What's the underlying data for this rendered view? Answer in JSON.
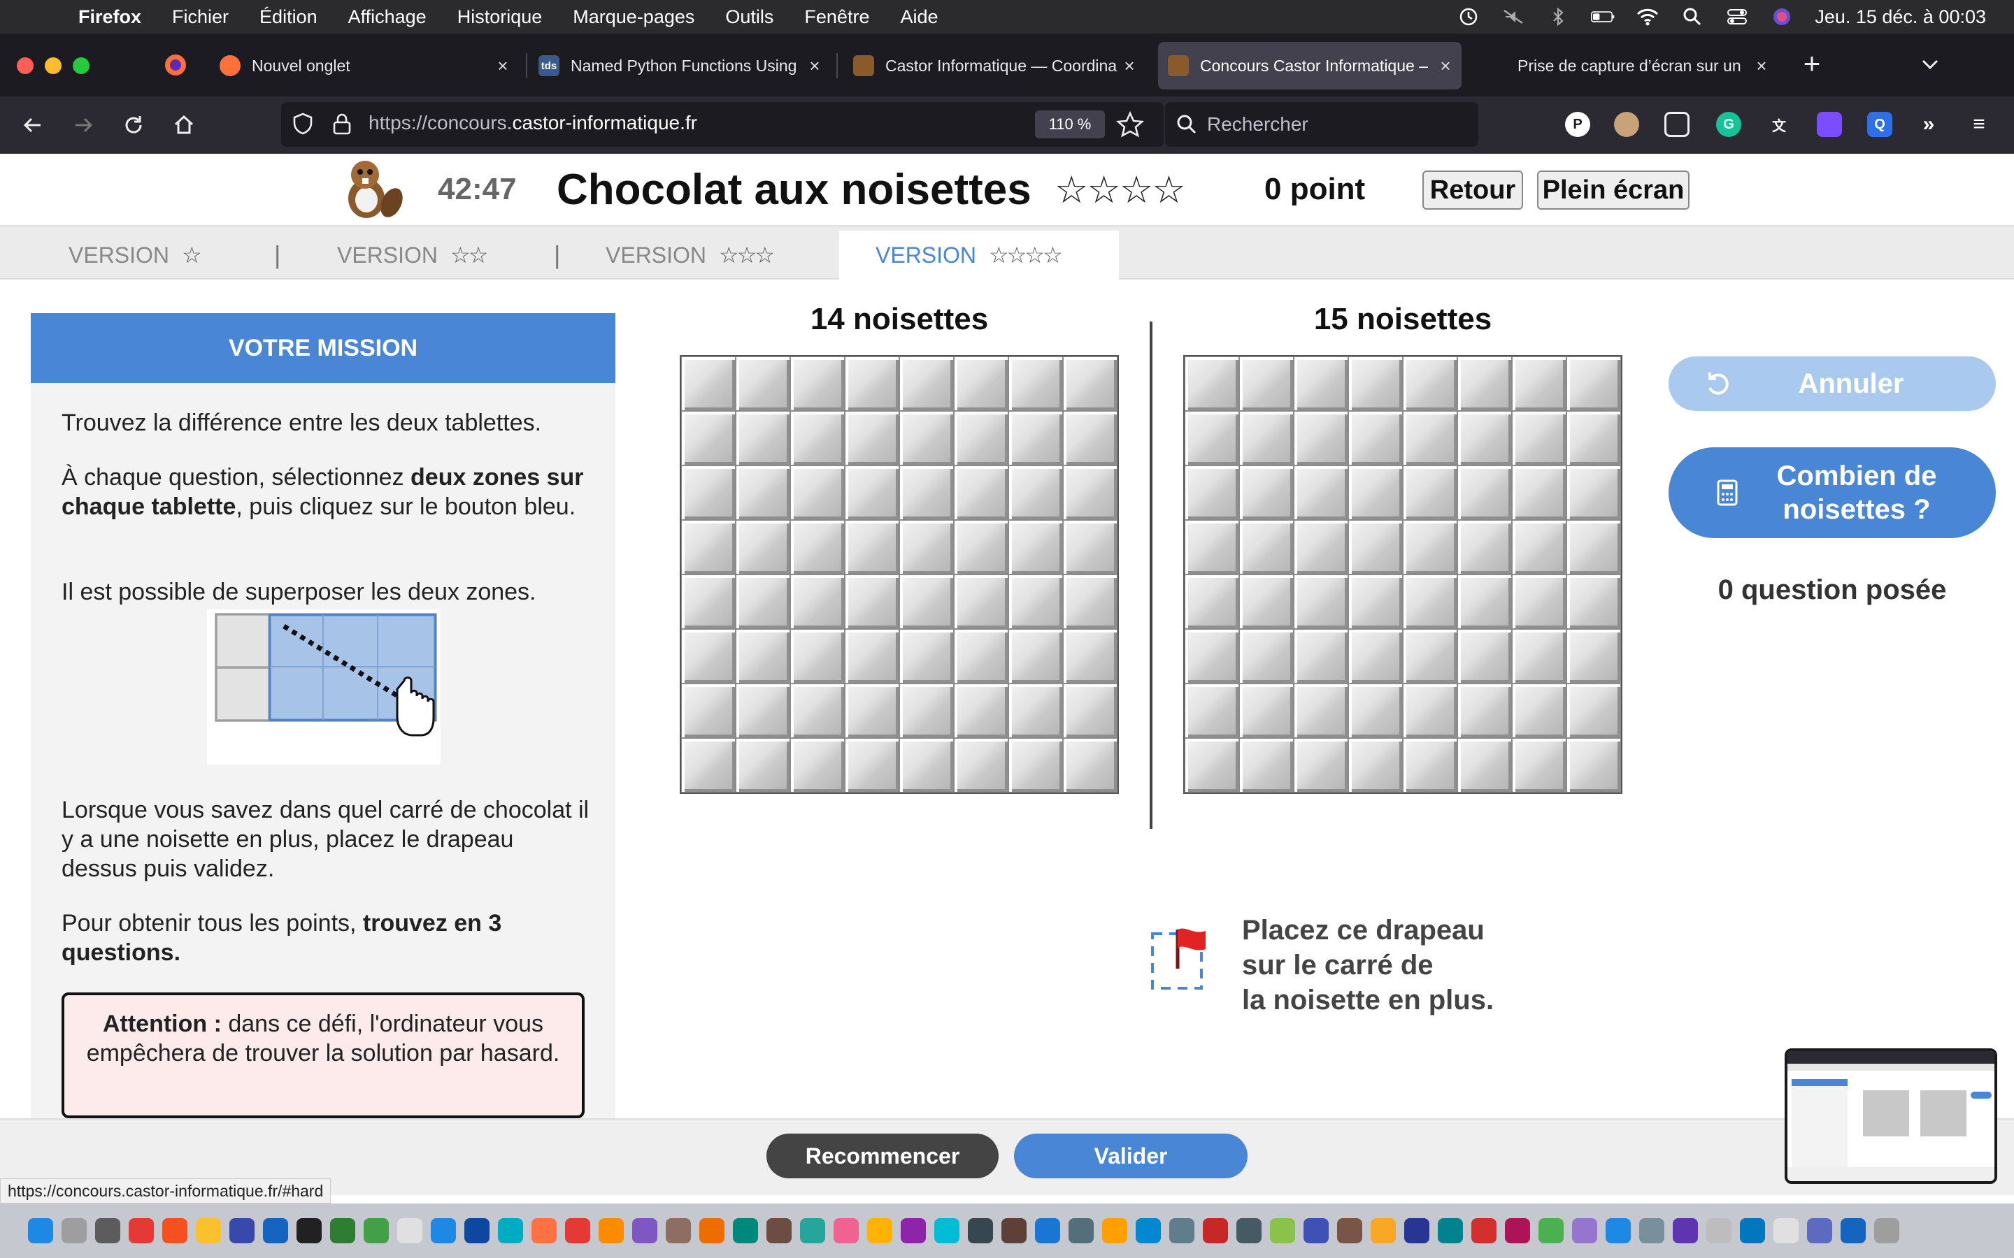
{
  "menubar": {
    "app": "Firefox",
    "items": [
      "Fichier",
      "Édition",
      "Affichage",
      "Historique",
      "Marque-pages",
      "Outils",
      "Fenêtre",
      "Aide"
    ],
    "clock": "Jeu. 15 déc. à 00:03"
  },
  "browser": {
    "tabs": [
      {
        "title": "Nouvel onglet",
        "icon": "firefox-icon"
      },
      {
        "title": "Named Python Functions Using",
        "icon": "tds-icon"
      },
      {
        "title": "Castor Informatique — Coordina",
        "icon": "castor-icon"
      },
      {
        "title": "Concours Castor Informatique –",
        "icon": "castor-icon"
      },
      {
        "title": "Prise de capture d’écran sur un",
        "icon": "apple-icon"
      }
    ],
    "url_prefix": "https://concours.",
    "url_domain": "castor-informatique.fr",
    "zoom": "110 %",
    "search_placeholder": "Rechercher"
  },
  "task": {
    "timer": "42:47",
    "title": "Chocolat aux noisettes",
    "title_stars": "☆☆☆☆",
    "score": "0 point",
    "back_label": "Retour",
    "fullscreen_label": "Plein écran"
  },
  "versions": [
    {
      "label": "VERSION",
      "stars": "☆"
    },
    {
      "label": "VERSION",
      "stars": "☆☆"
    },
    {
      "label": "VERSION",
      "stars": "☆☆☆"
    },
    {
      "label": "VERSION",
      "stars": "☆☆☆☆"
    }
  ],
  "version_separator": "|",
  "mission": {
    "header": "VOTRE MISSION",
    "p1": "Trouvez la différence entre les deux tablettes.",
    "p2_a": "À chaque question, sélectionnez ",
    "p2_b": "deux zones sur chaque tablette",
    "p2_c": ", puis cliquez sur le bouton bleu.",
    "p3": "Il est possible de superposer les deux zones.",
    "p4": "Lorsque vous savez dans quel carré de chocolat il y a une noisette en plus, placez le drapeau dessus puis validez.",
    "p5_a": "Pour obtenir tous les points, ",
    "p5_b": "trouvez en 3 questions.",
    "attn_a": "Attention :",
    "attn_b": " dans ce défi, l'ordinateur vous empêchera de trouver la solution par hasard."
  },
  "tablets": {
    "left_label": "14 noisettes",
    "right_label": "15 noisettes",
    "rows": 8,
    "cols": 8
  },
  "controls": {
    "undo_label": "Annuler",
    "ask_label": "Combien de noisettes ?",
    "questions_count": "0 question posée",
    "flag_text_1": "Placez ce drapeau",
    "flag_text_2": "sur le carré de",
    "flag_text_3": "la noisette en plus."
  },
  "bottom": {
    "restart_label": "Recommencer",
    "validate_label": "Valider",
    "status_url": "https://concours.castor-informatique.fr/#hard"
  },
  "colors": {
    "accent_blue": "#4a86d6",
    "undo_disabled": "#a9c9ee",
    "attention_bg": "#fdeaea"
  }
}
